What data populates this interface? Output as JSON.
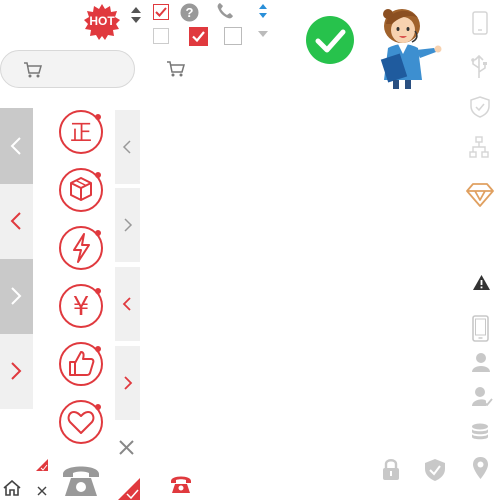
{
  "hot_badge": {
    "label": "HOT"
  },
  "colors": {
    "red": "#e0393e",
    "green": "#27c24c",
    "gray_icon": "#cfcfcf",
    "gold": "#e0a060",
    "dark": "#333333"
  },
  "top_icons": [
    "sort-arrows-icon",
    "checkbox-checked-icon",
    "help-icon",
    "phone-icon",
    "sort-blue-icon",
    "checkbox-unchecked-icon",
    "checkbox-red-checked-icon",
    "checkbox-empty-icon",
    "dropdown-icon",
    "success-check-icon"
  ],
  "left_arrows": [
    "chevron-left",
    "chevron-left",
    "chevron-right",
    "chevron-right"
  ],
  "feature_icons": [
    "zheng-genuine-icon",
    "package-cube-icon",
    "lightning-icon",
    "yen-icon",
    "thumbs-up-icon",
    "heart-icon"
  ],
  "right_sidebar_icons": [
    "phone-icon",
    "usb-icon",
    "shield-check-icon",
    "network-icon",
    "diamond-icon",
    "warning-icon",
    "mobile-icon",
    "user-icon",
    "user-verified-icon",
    "database-icon",
    "location-icon"
  ],
  "bottom_icons": [
    "home-icon",
    "close-icon",
    "telephone-icon",
    "red-telephone-icon",
    "lock-icon",
    "shield-icon"
  ],
  "feature_zheng_char": "正",
  "feature_yen_char": "¥"
}
